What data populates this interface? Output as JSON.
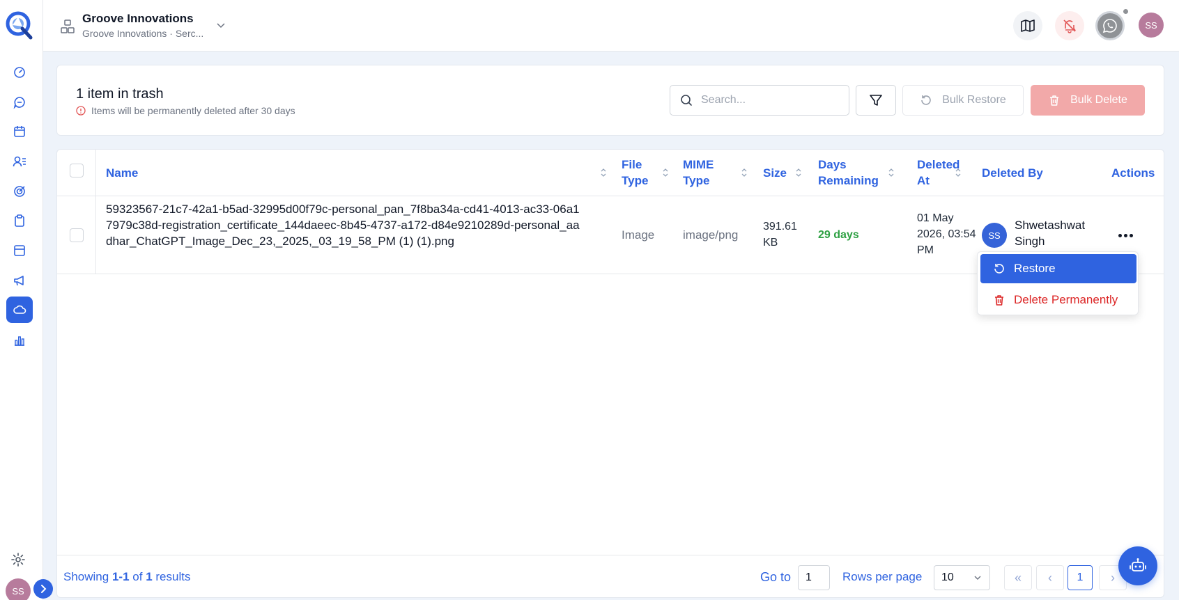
{
  "header": {
    "org_name": "Groove Innovations",
    "org_sub": "Groove Innovations · Serc...",
    "user_initials": "SS"
  },
  "sidebar": {
    "items": [
      "dashboard",
      "chat",
      "calendar",
      "contacts",
      "targets",
      "clipboard",
      "cards",
      "campaigns",
      "cloud",
      "analytics"
    ],
    "active_item": "cloud",
    "user_initials": "SS"
  },
  "trash": {
    "title": "1 item in trash",
    "note": "Items will be permanently deleted after 30 days",
    "search_placeholder": "Search...",
    "bulk_restore_label": "Bulk Restore",
    "bulk_delete_label": "Bulk Delete"
  },
  "table": {
    "headers": {
      "name": "Name",
      "file_type_1": "File",
      "file_type_2": "Type",
      "mime_type_1": "MIME",
      "mime_type_2": "Type",
      "size": "Size",
      "days_1": "Days",
      "days_2": "Remaining",
      "deleted_at_1": "Deleted",
      "deleted_at_2": "At",
      "deleted_by": "Deleted By",
      "actions": "Actions"
    },
    "rows": [
      {
        "name": "59323567-21c7-42a1-b5ad-32995d00f79c-personal_pan_7f8ba34a-cd41-4013-ac33-06a17979c38d-registration_certificate_144daeec-8b45-4737-a172-d84e9210289d-personal_aadhar_ChatGPT_Image_Dec_23,_2025,_03_19_58_PM (1) (1).png",
        "file_type": "Image",
        "mime_type": "image/png",
        "size_1": "391.61",
        "size_2": "KB",
        "days_remaining": "29 days",
        "deleted_at_1": "01 May",
        "deleted_at_2": "2026, 03:54",
        "deleted_at_3": "PM",
        "deleted_by_initials": "SS",
        "deleted_by_1": "Shwetashwat",
        "deleted_by_2": "Singh"
      }
    ]
  },
  "menu": {
    "restore_label": "Restore",
    "delete_label": "Delete Permanently"
  },
  "footer": {
    "showing_prefix": "Showing",
    "showing_range": "1-1",
    "showing_of": "of",
    "showing_total": "1",
    "showing_suffix": "results",
    "goto_label": "Go to",
    "goto_value": "1",
    "rows_label": "Rows per page",
    "rows_value": "10",
    "first_glyph": "«",
    "prev_glyph": "‹",
    "current_page": "1",
    "next_glyph": "›"
  },
  "colors": {
    "accent": "#2f63e0",
    "danger": "#dc2626",
    "success": "#2ea043"
  }
}
